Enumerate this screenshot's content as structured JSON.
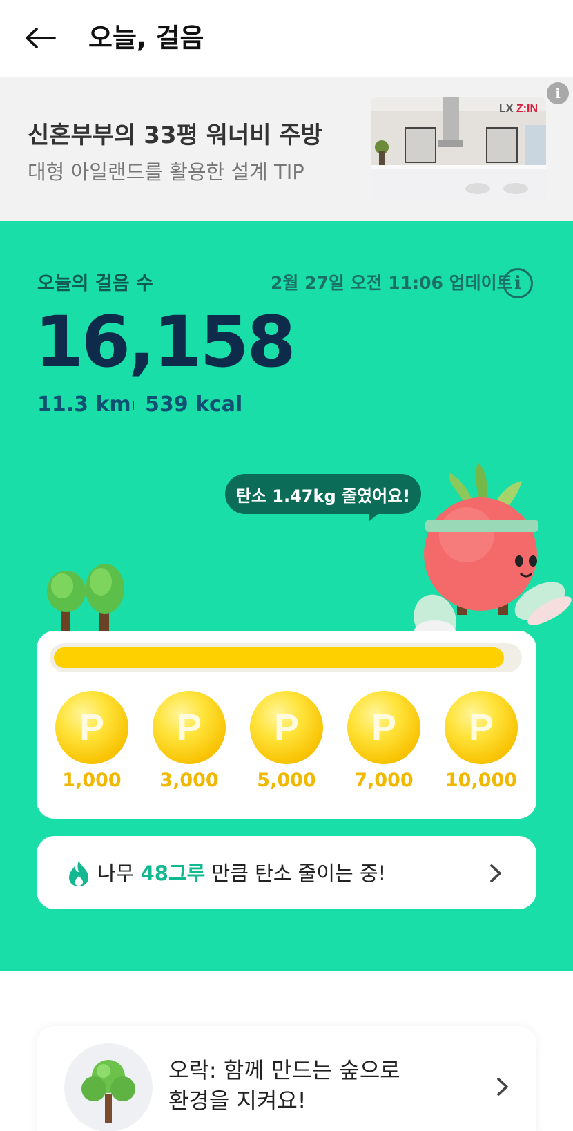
{
  "header": {
    "title": "오늘, 걸음"
  },
  "ad": {
    "title": "신혼부부의 33평 워너비 주방",
    "subtitle": "대형 아일랜드를 활용한 설계 TIP",
    "brand": "LX Z:IN",
    "info_glyph": "i"
  },
  "steps": {
    "label": "오늘의 걸음 수",
    "update": "2월 27일 오전 11:06 업데이트",
    "info_glyph": "i",
    "count": "16,158",
    "distance": "11.3 km",
    "calories": "539 kcal"
  },
  "carbon": {
    "message": "탄소 1.47kg 줄였어요!"
  },
  "rewards": {
    "progress": 0.97,
    "coin_glyph": "P",
    "milestones": [
      "1,000",
      "3,000",
      "5,000",
      "7,000",
      "10,000"
    ]
  },
  "trees": {
    "prefix": "나무 ",
    "count": "48그루",
    "suffix": " 만큼 탄소 줄이는 중!"
  },
  "orak": {
    "line1": "오락: 함께 만드는 숲으로",
    "line2": "환경을 지켜요!"
  },
  "colors": {
    "green_bg": "#19dea8",
    "dark_navy": "#0e2b4c",
    "teal_text": "#1c6f66",
    "coin_yellow": "#ffd000",
    "highlight": "#12b890"
  }
}
